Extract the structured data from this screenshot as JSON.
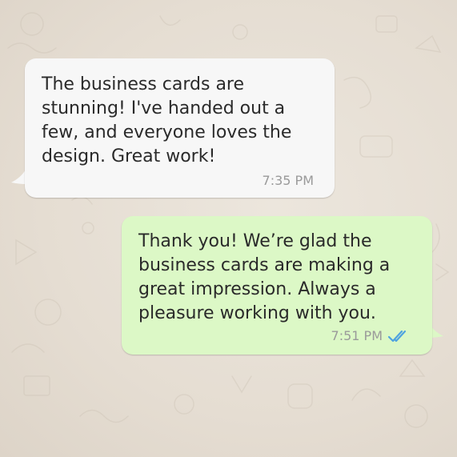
{
  "conversation": {
    "messages": [
      {
        "direction": "incoming",
        "text": "The business cards are\nstunning! I've handed out a\nfew, and everyone loves the\ndesign. Great work!",
        "time": "7:35 PM"
      },
      {
        "direction": "outgoing",
        "text": "Thank you! We’re glad the\nbusiness cards are making a\ngreat impression. Always a\npleasure working with you.",
        "time": "7:51 PM",
        "status_icon": "double-check-read-icon"
      }
    ]
  },
  "colors": {
    "incoming_bubble": "#f7f7f7",
    "outgoing_bubble": "#dcf8c6",
    "read_ticks": "#4fa3e0",
    "chat_background": "#e7e0d6"
  }
}
